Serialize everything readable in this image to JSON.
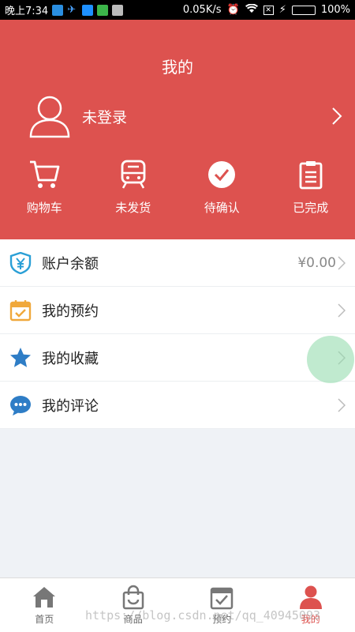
{
  "status_bar": {
    "time": "晚上7:34",
    "net_speed": "0.05K/s",
    "battery": "100%",
    "battery_level": 1.0
  },
  "header": {
    "title": "我的",
    "login_label": "未登录",
    "background_color": "#dd524f"
  },
  "shortcuts": [
    {
      "label": "购物车",
      "icon": "cart-icon"
    },
    {
      "label": "未发货",
      "icon": "train-icon"
    },
    {
      "label": "待确认",
      "icon": "check-circle-icon"
    },
    {
      "label": "已完成",
      "icon": "clipboard-icon"
    }
  ],
  "menu": [
    {
      "label": "账户余额",
      "value": "¥0.00",
      "icon": "yuan-shield-icon",
      "icon_color": "#2a9fd6"
    },
    {
      "label": "我的预约",
      "value": "",
      "icon": "calendar-check-icon",
      "icon_color": "#f0a83b"
    },
    {
      "label": "我的收藏",
      "value": "",
      "icon": "star-icon",
      "icon_color": "#2e7dc6"
    },
    {
      "label": "我的评论",
      "value": "",
      "icon": "chat-bubble-icon",
      "icon_color": "#2e7dc6"
    }
  ],
  "tabs": [
    {
      "label": "首页",
      "icon": "home-icon",
      "active": false
    },
    {
      "label": "商品",
      "icon": "shopping-bag-icon",
      "active": false
    },
    {
      "label": "预约",
      "icon": "calendar-check-icon",
      "active": false
    },
    {
      "label": "我的",
      "icon": "person-icon",
      "active": true
    }
  ],
  "watermark": "https://blog.csdn.net/qq_40945093"
}
